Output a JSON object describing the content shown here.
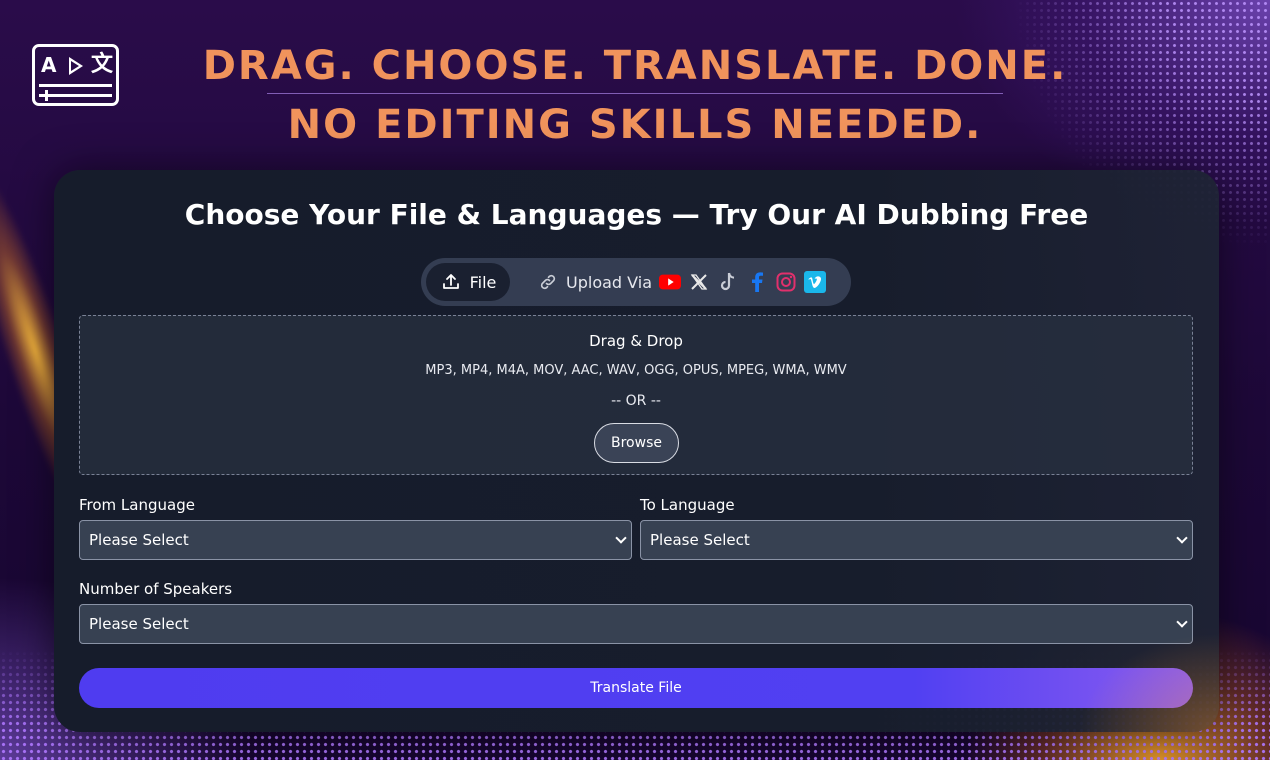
{
  "headline": {
    "line1": "DRAG. CHOOSE. TRANSLATE. DONE.",
    "line2": "NO EDITING SKILLS NEEDED."
  },
  "logo": {
    "icon": "translate-video-logo-icon",
    "letter_a": "A",
    "letter_x": "文"
  },
  "card": {
    "title": "Choose Your File & Languages — Try Our AI Dubbing Free",
    "tabs": {
      "file": {
        "label": "File",
        "icon": "upload-icon"
      },
      "upload_via": {
        "label": "Upload Via",
        "icon": "link-icon",
        "sources": [
          "youtube-icon",
          "x-icon",
          "tiktok-icon",
          "facebook-icon",
          "instagram-icon",
          "vimeo-icon"
        ]
      }
    },
    "dropzone": {
      "title": "Drag & Drop",
      "formats": "MP3, MP4, M4A, MOV, AAC, WAV, OGG, OPUS, MPEG, WMA, WMV",
      "or": "-- OR --",
      "browse_label": "Browse"
    },
    "from_language": {
      "label": "From Language",
      "value": "Please Select"
    },
    "to_language": {
      "label": "To Language",
      "value": "Please Select"
    },
    "speakers": {
      "label": "Number of Speakers",
      "value": "Please Select"
    },
    "translate_label": "Translate File"
  },
  "colors": {
    "headline": "#f0935c",
    "accent": "#4f3cf0",
    "card_bg": "#161c2b",
    "youtube": "#ff0000",
    "facebook": "#1877f2",
    "instagram": "#e1306c",
    "vimeo": "#1ab7ea"
  }
}
